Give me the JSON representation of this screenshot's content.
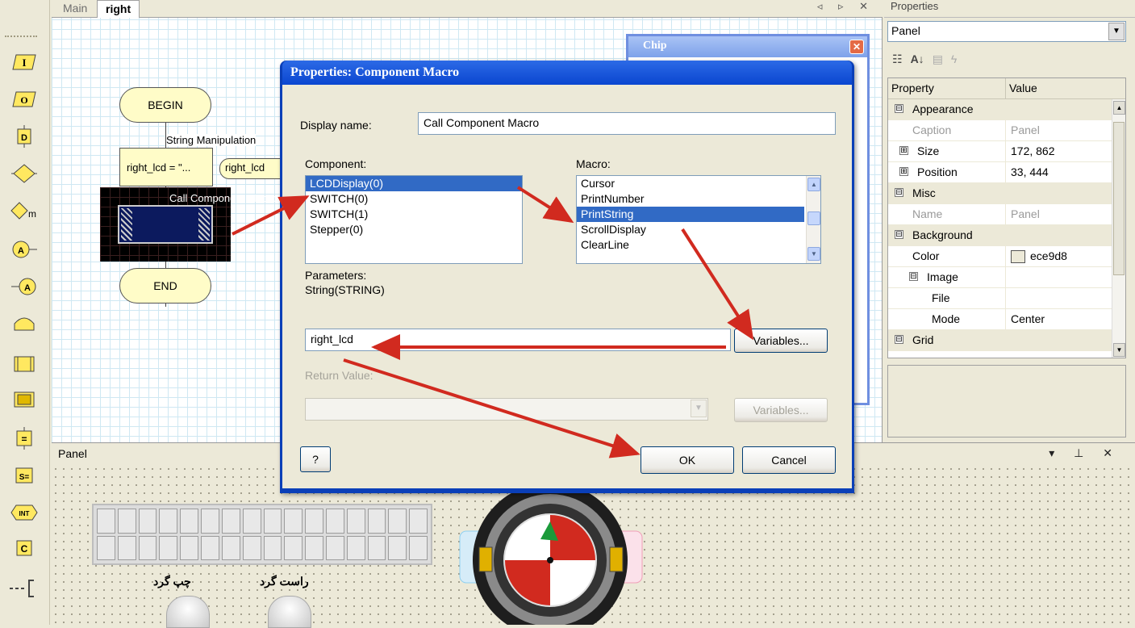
{
  "tabs": [
    {
      "label": "Main"
    },
    {
      "label": "right"
    }
  ],
  "flowchart": {
    "begin": "BEGIN",
    "end": "END",
    "string_label": "String Manipulation",
    "calc_text": "right_lcd = \"...",
    "input_text": "right_lcd",
    "component_label": "Call Component Macro"
  },
  "chip_window": {
    "title": "Chip",
    "close": "✕"
  },
  "properties_pane": {
    "title": "Properties",
    "selected_object": "Panel",
    "columns": {
      "property": "Property",
      "value": "Value"
    },
    "rows": [
      {
        "type": "cat",
        "name": "Appearance",
        "expander": "⊟"
      },
      {
        "type": "prop",
        "name": "Caption",
        "value": "Panel",
        "disabled": true
      },
      {
        "type": "prop",
        "name": "Size",
        "value": "172, 862",
        "expander": "⊞"
      },
      {
        "type": "prop",
        "name": "Position",
        "value": "33, 444",
        "expander": "⊞"
      },
      {
        "type": "cat",
        "name": "Misc",
        "expander": "⊟"
      },
      {
        "type": "prop",
        "name": "Name",
        "value": "Panel",
        "disabled": true
      },
      {
        "type": "cat",
        "name": "Background",
        "expander": "⊟"
      },
      {
        "type": "prop",
        "name": "Color",
        "value": "ece9d8",
        "swatch": "#ece9d8"
      },
      {
        "type": "prop",
        "name": "Image",
        "value": "",
        "expander": "⊟"
      },
      {
        "type": "prop",
        "name": "File",
        "value": ""
      },
      {
        "type": "prop",
        "name": "Mode",
        "value": "Center"
      },
      {
        "type": "cat",
        "name": "Grid",
        "expander": "⊟"
      }
    ]
  },
  "panel": {
    "title": "Panel",
    "left_switch_label": "چپ گرد",
    "right_switch_label": "راست گرد"
  },
  "dialog": {
    "title": "Properties: Component Macro",
    "display_name_label": "Display name:",
    "display_name_value": "Call Component Macro",
    "component_label": "Component:",
    "components": [
      "LCDDisplay(0)",
      "SWITCH(0)",
      "SWITCH(1)",
      "Stepper(0)"
    ],
    "selected_component": 0,
    "macro_label": "Macro:",
    "macros": [
      "Cursor",
      "PrintNumber",
      "PrintString",
      "ScrollDisplay",
      "ClearLine"
    ],
    "selected_macro": 2,
    "parameters_label": "Parameters:",
    "parameters_value": "String(STRING)",
    "parameter_input": "right_lcd",
    "variables_button": "Variables...",
    "return_value_label": "Return Value:",
    "variables_button_2": "Variables...",
    "help_button": "?",
    "ok_button": "OK",
    "cancel_button": "Cancel"
  },
  "colors": {
    "accent": "#316ac5",
    "title_bar": "#0a46d0",
    "arrow": "#d12a1f",
    "background": "#ece9d8"
  }
}
